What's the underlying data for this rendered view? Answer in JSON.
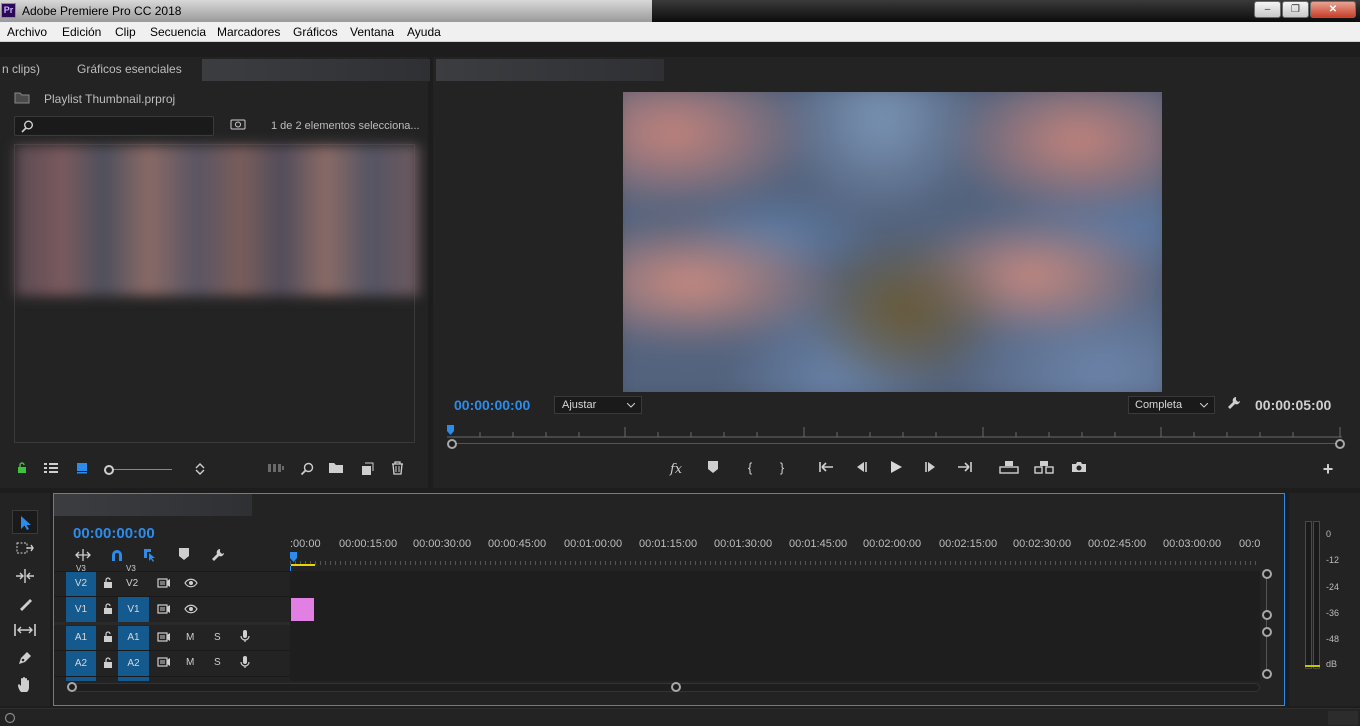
{
  "window": {
    "title": "Adobe Premiere Pro CC 2018",
    "logo_text": "Pr",
    "minimize": "‒",
    "restore": "❐",
    "close": "✕"
  },
  "menu": [
    "Archivo",
    "Edición",
    "Clip",
    "Secuencia",
    "Marcadores",
    "Gráficos",
    "Ventana",
    "Ayuda"
  ],
  "project_panel": {
    "tab_partial": "n clips)",
    "tab_graphics": "Gráficos esenciales",
    "project_file": "Playlist Thumbnail.prproj",
    "selection_status": "1 de 2 elementos selecciona..."
  },
  "program_monitor": {
    "current_time": "00:00:00:00",
    "fit_option": "Ajustar",
    "resolution_option": "Completa",
    "duration": "00:00:05:00",
    "fx_label": "fx"
  },
  "timeline": {
    "current_time": "00:00:00:00",
    "ruler_labels": [
      ":00:00",
      "00:00:15:00",
      "00:00:30:00",
      "00:00:45:00",
      "00:01:00:00",
      "00:01:15:00",
      "00:01:30:00",
      "00:01:45:00",
      "00:02:00:00",
      "00:02:15:00",
      "00:02:30:00",
      "00:02:45:00",
      "00:03:00:00",
      "00:0"
    ],
    "tracks": {
      "v2_src": "V2",
      "v2_tgt": "V2",
      "v1_src": "V1",
      "v1_tgt": "V1",
      "a1_src": "A1",
      "a1_tgt": "A1",
      "a2_src": "A2",
      "a2_tgt": "A2",
      "mute": "M",
      "solo": "S",
      "v3_partial": "V3"
    }
  },
  "audio_meter": {
    "labels": [
      "0",
      "-12",
      "-24",
      "-36",
      "-48",
      "dB"
    ]
  },
  "colors": {
    "accent_blue": "#2d8ceb",
    "track_blue": "#145a8e",
    "clip_pink": "#e27fe3",
    "playhead_yellow": "#e8d400"
  }
}
